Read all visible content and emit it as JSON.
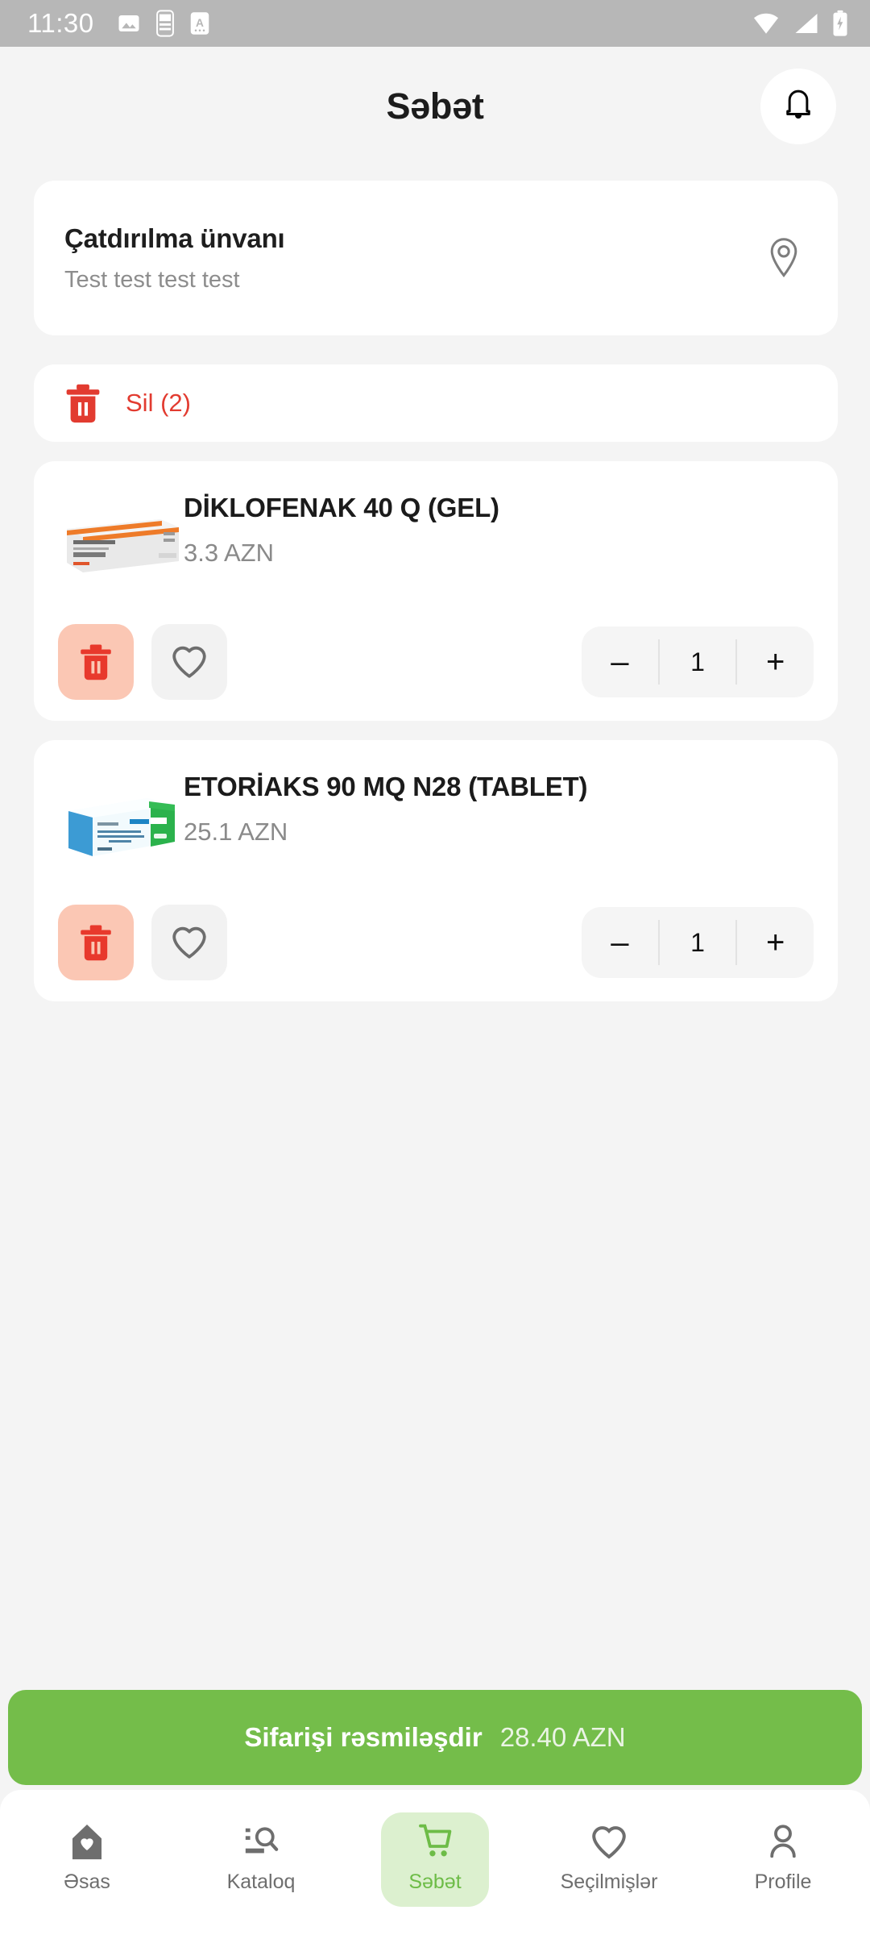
{
  "status_bar": {
    "time": "11:30",
    "left_icons": [
      "image-icon",
      "battery-saver-icon",
      "font-size-icon"
    ],
    "right_icons": [
      "wifi-icon",
      "cellular-signal-icon",
      "battery-charging-icon"
    ]
  },
  "header": {
    "title": "Səbət",
    "notification_icon": "bell-icon"
  },
  "address": {
    "title": "Çatdırılma ünvanı",
    "value": "Test test test test",
    "icon": "location-pin-icon"
  },
  "delete_all": {
    "label": "Sil (2)",
    "icon": "trash-icon",
    "color": "#E23B30"
  },
  "products": [
    {
      "name": "DİKLOFENAK 40 Q (GEL)",
      "price": "3.3 AZN",
      "quantity": "1",
      "delete_icon": "trash-icon",
      "favorite_icon": "heart-icon",
      "decrement_label": "–",
      "increment_label": "+",
      "thumb_type": "gel-box"
    },
    {
      "name": "ETORİAKS 90 MQ N28 (TABLET)",
      "price": "25.1 AZN",
      "quantity": "1",
      "delete_icon": "trash-icon",
      "favorite_icon": "heart-icon",
      "decrement_label": "–",
      "increment_label": "+",
      "thumb_type": "tablet-box"
    }
  ],
  "checkout": {
    "label": "Sifarişi rəsmiləşdir",
    "total": "28.40 AZN",
    "color": "#74BD4A"
  },
  "bottom_nav": {
    "active_color": "#6DBC47",
    "items": [
      {
        "label": "Əsas",
        "icon": "home-heart-icon",
        "active": false
      },
      {
        "label": "Kataloq",
        "icon": "search-list-icon",
        "active": false
      },
      {
        "label": "Səbət",
        "icon": "cart-icon",
        "active": true
      },
      {
        "label": "Seçilmişlər",
        "icon": "heart-icon",
        "active": false
      },
      {
        "label": "Profile",
        "icon": "person-icon",
        "active": false
      }
    ]
  }
}
